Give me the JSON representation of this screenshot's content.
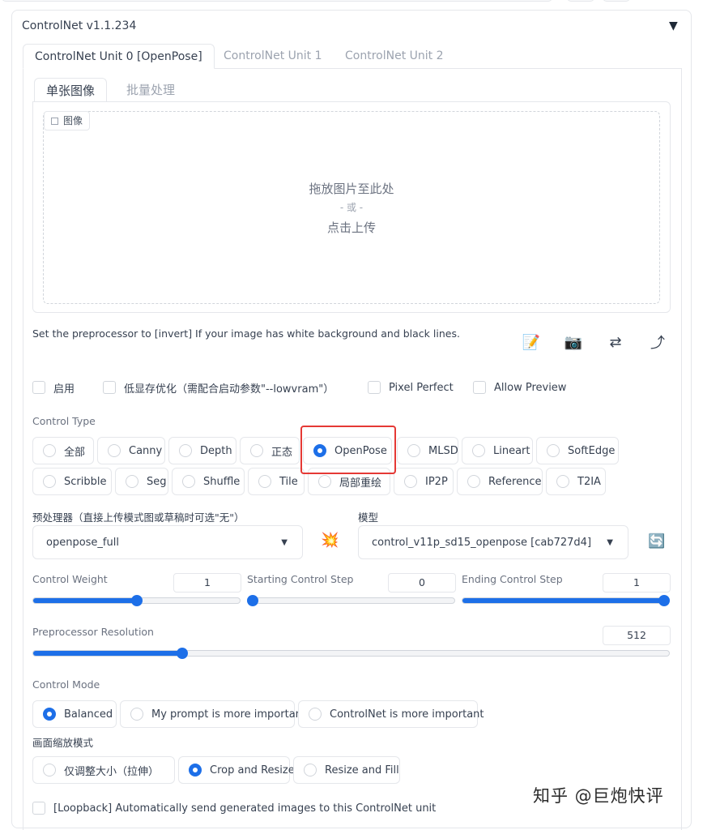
{
  "panel": {
    "title": "ControlNet v1.1.234",
    "collapse_icon": "▼"
  },
  "unit_tabs": [
    {
      "label": "ControlNet Unit 0 [OpenPose]"
    },
    {
      "label": "ControlNet Unit 1"
    },
    {
      "label": "ControlNet Unit 2"
    }
  ],
  "image_tabs": [
    {
      "label": "单张图像"
    },
    {
      "label": "批量处理"
    }
  ],
  "image": {
    "label": "图像",
    "drop_line1": "拖放图片至此处",
    "drop_or": "- 或 -",
    "drop_line2": "点击上传"
  },
  "hint": "Set the preprocessor to [invert] If your image has white background and black lines.",
  "tools": [
    {
      "icon": "📝",
      "name": "notepad-icon"
    },
    {
      "icon": "📷",
      "name": "camera-icon"
    },
    {
      "icon": "⇄",
      "name": "swap-arrows-icon"
    },
    {
      "icon": "⤴",
      "name": "send-arrow-icon"
    }
  ],
  "checks": [
    {
      "label": "启用"
    },
    {
      "label": "低显存优化（需配合启动参数\"--lowvram\"）"
    },
    {
      "label": "Pixel Perfect"
    },
    {
      "label": "Allow Preview"
    }
  ],
  "control_type": {
    "label": "Control Type",
    "row1": [
      "全部",
      "Canny",
      "Depth",
      "正态",
      "OpenPose",
      "MLSD",
      "Lineart",
      "SoftEdge"
    ],
    "row2": [
      "Scribble",
      "Seg",
      "Shuffle",
      "Tile",
      "局部重绘",
      "IP2P",
      "Reference",
      "T2IA"
    ],
    "selected": "OpenPose"
  },
  "preprocessor": {
    "label": "预处理器（直接上传模式图或草稿时可选\"无\"）",
    "value": "openpose_full",
    "caret": "▼",
    "run_icon": "💥"
  },
  "model": {
    "label": "模型",
    "value": "control_v11p_sd15_openpose [cab727d4]",
    "caret": "▼",
    "refresh_icon": "🔄"
  },
  "sliders": {
    "control_weight": {
      "label": "Control Weight",
      "value": "1",
      "level": 0.5
    },
    "starting_step": {
      "label": "Starting Control Step",
      "value": "0",
      "level": 0
    },
    "ending_step": {
      "label": "Ending Control Step",
      "value": "1",
      "level": 1
    },
    "preprocessor_res": {
      "label": "Preprocessor Resolution",
      "value": "512",
      "level": 0.23
    }
  },
  "control_mode": {
    "label": "Control Mode",
    "options": [
      "Balanced",
      "My prompt is more important",
      "ControlNet is more important"
    ],
    "selected": "Balanced"
  },
  "resize_mode": {
    "label": "画面缩放模式",
    "options": [
      "仅调整大小（拉伸）",
      "Crop and Resize",
      "Resize and Fill"
    ],
    "selected": "Crop and Resize"
  },
  "loopback": {
    "label": "[Loopback] Automatically send generated images to this ControlNet unit"
  },
  "watermark": "知乎 @巨炮快评",
  "colors": {
    "accent": "#1d6fe8",
    "highlight": "#e53935",
    "border": "#e5e7eb"
  }
}
